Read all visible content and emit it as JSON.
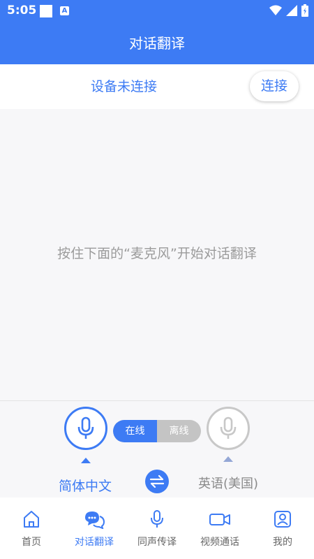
{
  "status_bar": {
    "time": "5:05",
    "notif_badge": "A"
  },
  "header": {
    "title": "对话翻译"
  },
  "device": {
    "status": "设备未连接",
    "connect_label": "连接"
  },
  "conversation": {
    "hint": "按住下面的“麦克风”开始对话翻译"
  },
  "controls": {
    "mode_online": "在线",
    "mode_offline": "离线",
    "selected_mode": "在线",
    "source_lang": "简体中文",
    "target_lang": "英语(美国)"
  },
  "nav": {
    "active": "对话翻译",
    "items": [
      {
        "label": "首页",
        "icon": "home-icon"
      },
      {
        "label": "对话翻译",
        "icon": "chat-bubbles-icon"
      },
      {
        "label": "同声传译",
        "icon": "microphone-icon"
      },
      {
        "label": "视频通话",
        "icon": "video-camera-icon"
      },
      {
        "label": "我的",
        "icon": "user-profile-icon"
      }
    ]
  },
  "colors": {
    "primary": "#3d7bf4",
    "inactive": "#c4c4c4",
    "hint_text": "#9b9b9b"
  }
}
